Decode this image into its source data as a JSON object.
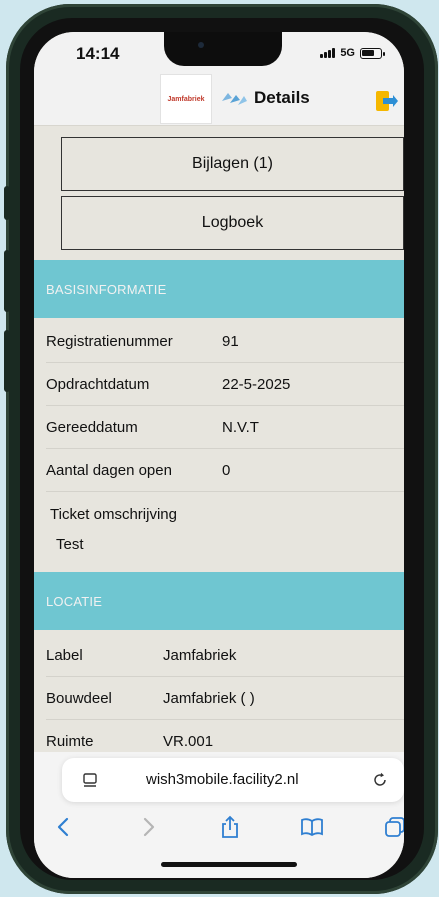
{
  "status": {
    "time": "14:14",
    "network": "5G",
    "battery_level": 0.7
  },
  "header": {
    "logo_text": "Jamfabriek",
    "title": "Details"
  },
  "buttons": {
    "attachments": "Bijlagen (1)",
    "logbook": "Logboek"
  },
  "basis": {
    "heading": "BASISINFORMATIE",
    "rows": [
      {
        "label": "Registratienummer",
        "value": "91"
      },
      {
        "label": "Opdrachtdatum",
        "value": "22-5-2025"
      },
      {
        "label": "Gereeddatum",
        "value": "N.V.T"
      },
      {
        "label": "Aantal dagen open",
        "value": "0"
      }
    ],
    "description_label": "Ticket omschrijving",
    "description_value": "Test"
  },
  "locatie": {
    "heading": "LOCATIE",
    "rows": [
      {
        "label": "Label",
        "value": "Jamfabriek"
      },
      {
        "label": "Bouwdeel",
        "value": "Jamfabriek ( )"
      },
      {
        "label": "Ruimte",
        "value": "VR.001"
      }
    ]
  },
  "browser": {
    "url": "wish3mobile.facility2.nl"
  },
  "colors": {
    "section_header": "#6fc6d1",
    "background": "#e7e5de",
    "accent": "#2f7fd1"
  }
}
